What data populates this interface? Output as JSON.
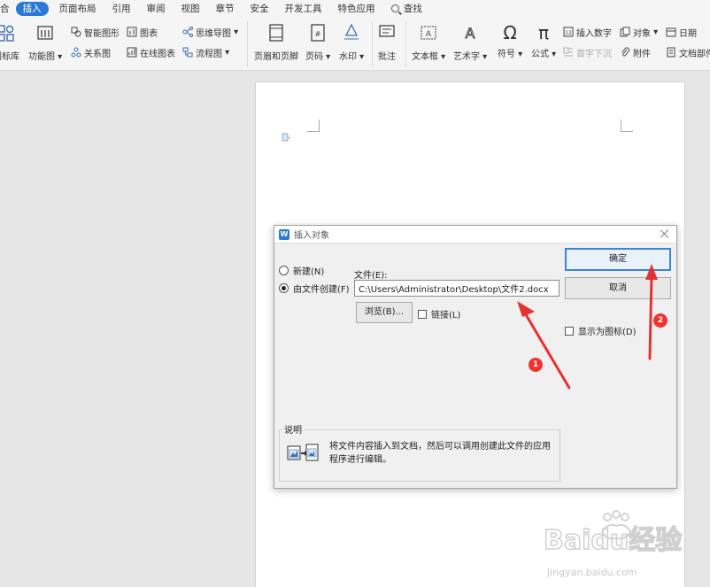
{
  "menu": {
    "items": [
      "合",
      "插入",
      "页面布局",
      "引用",
      "审阅",
      "视图",
      "章节",
      "安全",
      "开发工具",
      "特色应用"
    ],
    "active_index": 1,
    "search_label": "查找"
  },
  "ribbon": {
    "partial_left": "图标库",
    "function_chart": "功能图",
    "smart_shape": "智能图形",
    "chart": "图表",
    "mind_map": "思维导图",
    "relation_chart": "关系图",
    "online_chart": "在线图表",
    "flow_chart": "流程图",
    "header_footer": "页眉和页脚",
    "page_number": "页码",
    "watermark": "水印",
    "annotation": "批注",
    "textbox": "文本框",
    "art_text": "艺术字",
    "symbol": "符号",
    "formula": "公式",
    "insert_number": "插入数字",
    "object": "对象",
    "date": "日期",
    "drop_cap": "首字下沉",
    "attachment": "附件",
    "doc_parts": "文档部件"
  },
  "dialog": {
    "title": "插入对象",
    "radio_new": "新建(N)",
    "radio_from_file": "由文件创建(F)",
    "file_label": "文件(E):",
    "file_path": "C:\\Users\\Administrator\\Desktop\\文件2.docx",
    "browse_button": "浏览(B)...",
    "link_checkbox": "链接(L)",
    "ok_button": "确定",
    "cancel_button": "取消",
    "display_as_icon": "显示为图标(D)",
    "description_legend": "说明",
    "description_text": "将文件内容插入到文档，然后可以调用创建此文件的应用程序进行编辑。"
  },
  "annotations": {
    "badge_1": "1",
    "badge_2": "2"
  },
  "watermark": {
    "logo_text": "Baidu经验",
    "url": "jingyan.baidu.com"
  },
  "colors": {
    "accent": "#2b79d6",
    "arrow": "#e33333"
  }
}
